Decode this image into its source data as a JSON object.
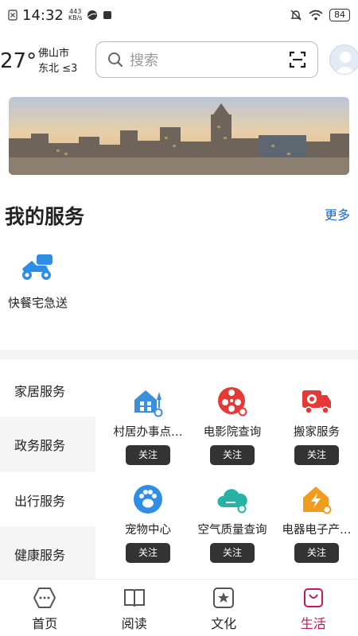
{
  "status_bar": {
    "time": "14:32",
    "net_speed_value": "443",
    "net_speed_unit": "KB/s",
    "battery": "84"
  },
  "header": {
    "temperature": "27°",
    "city": "佛山市",
    "wind": "东北 ≤3",
    "search_placeholder": "搜索"
  },
  "my_services": {
    "title": "我的服务",
    "more_label": "更多",
    "items": [
      {
        "label": "快餐宅急送",
        "icon": "scooter-icon",
        "color": "#2f8de4"
      }
    ]
  },
  "categories": [
    {
      "label": "家居服务",
      "active": false
    },
    {
      "label": "政务服务",
      "active": true
    },
    {
      "label": "出行服务",
      "active": false
    },
    {
      "label": "健康服务",
      "active": true
    }
  ],
  "service_grid": [
    {
      "label": "村居办事点…",
      "icon": "house-icon",
      "color": "#3a8fd8",
      "follow": "关注"
    },
    {
      "label": "电影院查询",
      "icon": "film-reel-icon",
      "color": "#e53935",
      "follow": "关注"
    },
    {
      "label": "搬家服务",
      "icon": "truck-icon",
      "color": "#e53935",
      "follow": "关注"
    },
    {
      "label": "宠物中心",
      "icon": "paw-icon",
      "color": "#2f8de4",
      "follow": "关注"
    },
    {
      "label": "空气质量查询",
      "icon": "cloud-icon",
      "color": "#26b3a5",
      "follow": "关注"
    },
    {
      "label": "电器电子产…",
      "icon": "electric-house-icon",
      "color": "#f29c1f",
      "follow": "关注"
    }
  ],
  "bottom_nav": [
    {
      "label": "首页",
      "icon": "home-hexagon-icon",
      "active": false
    },
    {
      "label": "阅读",
      "icon": "book-icon",
      "active": false
    },
    {
      "label": "文化",
      "icon": "star-badge-icon",
      "active": false
    },
    {
      "label": "生活",
      "icon": "bag-icon",
      "active": true
    }
  ],
  "colors": {
    "accent_link": "#1a66c6",
    "active_tab": "#c2185b",
    "follow_button": "#333333"
  }
}
